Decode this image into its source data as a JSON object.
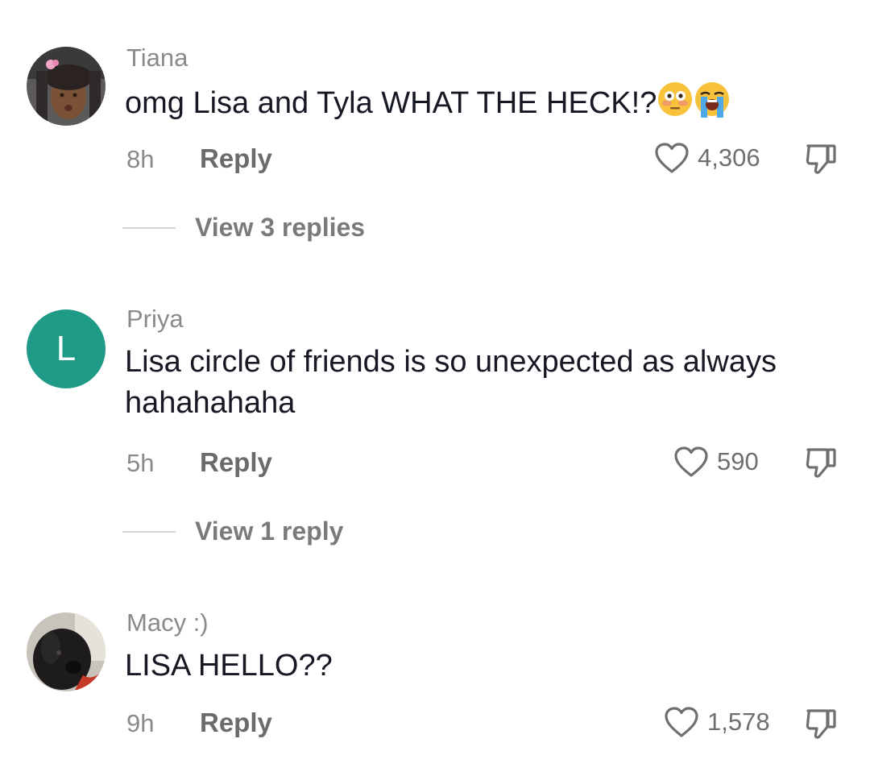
{
  "comments": [
    {
      "username": "Tiana",
      "text": "omg Lisa and Tyla WHAT THE HECK!?",
      "time": "8h",
      "reply_label": "Reply",
      "likes": "4,306",
      "view_replies": "View 3 replies",
      "avatar": "photo"
    },
    {
      "username": "Priya",
      "avatar_letter": "L",
      "avatar_color": "#1f9a87",
      "text": "Lisa circle of friends is so unexpected as always hahahahaha",
      "time": "5h",
      "reply_label": "Reply",
      "likes": "590",
      "view_replies": "View 1 reply"
    },
    {
      "username": "Macy :)",
      "text": "LISA HELLO??",
      "time": "9h",
      "reply_label": "Reply",
      "likes": "1,578",
      "avatar": "photo"
    }
  ],
  "icons": {
    "like": "heart-outline-icon",
    "dislike": "thumbs-down-icon",
    "emoji_1": "flushed-face-emoji",
    "emoji_2": "loudly-crying-face-emoji"
  }
}
